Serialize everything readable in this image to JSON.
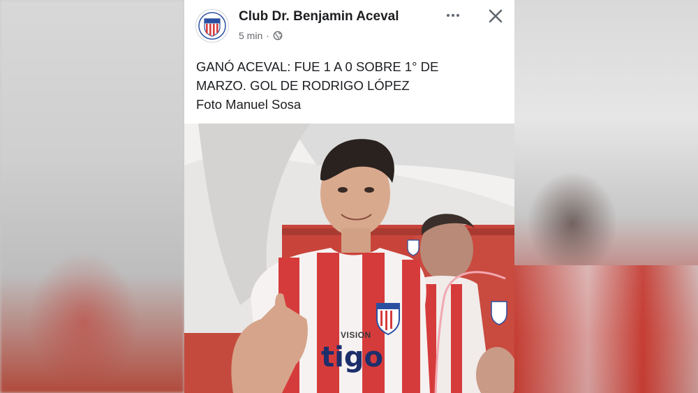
{
  "post": {
    "page_name": "Club Dr. Benjamin Aceval",
    "time": "5 min",
    "separator": "·",
    "audience_icon": "globe-icon",
    "more_icon": "more-options-icon",
    "close_icon": "close-icon",
    "text_lines": [
      "GANÓ ACEVAL: FUE 1 A 0 SOBRE 1° DE",
      "MARZO. GOL DE RODRIGO LÓPEZ",
      "Foto Manuel Sosa"
    ]
  },
  "photo": {
    "sponsor_top": "VISION",
    "sponsor_main": "tigo"
  },
  "colors": {
    "text_primary": "#1c1e21",
    "text_secondary": "#65676b",
    "jersey_red": "#d63b3b",
    "jersey_white": "#f6f2f2"
  }
}
